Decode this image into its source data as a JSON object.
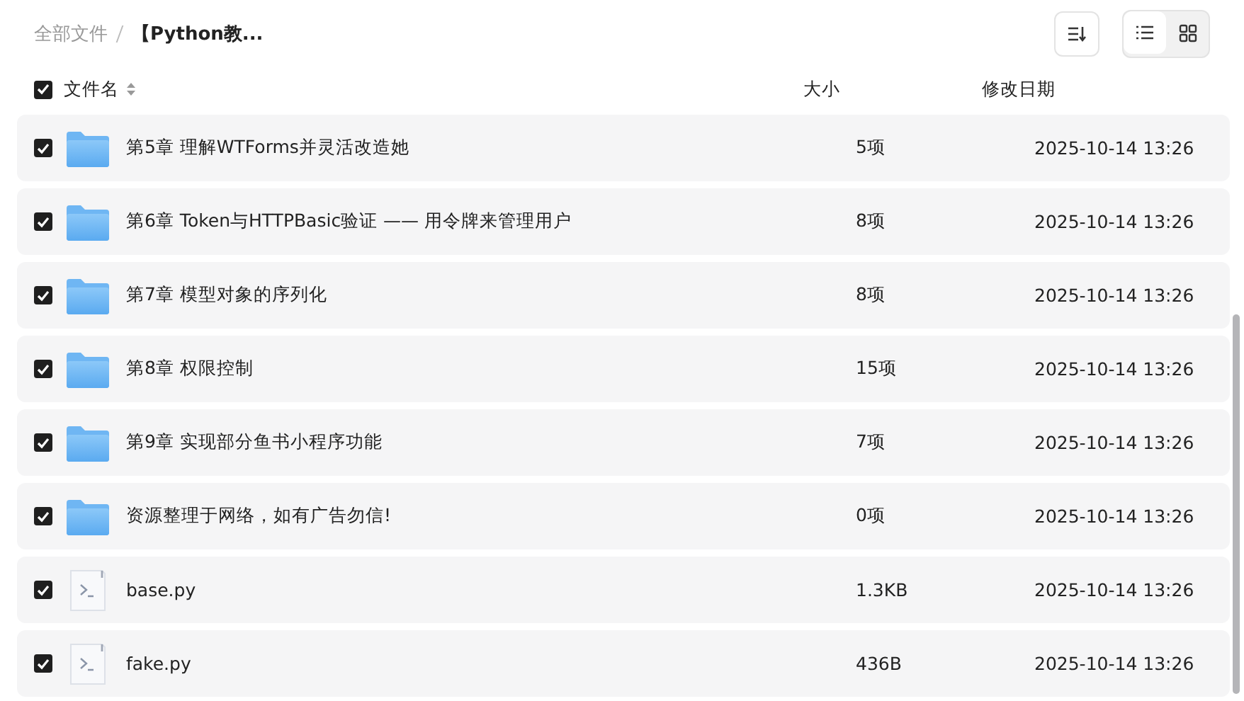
{
  "breadcrumb": [
    {
      "label": "全部文件",
      "current": false
    },
    {
      "label": "【Python教...",
      "current": true
    }
  ],
  "view_modes": [
    {
      "kind": "list",
      "selected": true
    },
    {
      "kind": "grid",
      "selected": false
    }
  ],
  "header": {
    "checked": true,
    "columns": [
      "文件名",
      "大小",
      "修改日期"
    ]
  },
  "rows": [
    {
      "kind": "folder",
      "name": "第5章 理解WTForms并灵活改造她",
      "size": "5项",
      "date": "2025-10-14 13:26",
      "checked": true
    },
    {
      "kind": "folder",
      "name": "第6章 Token与HTTPBasic验证 —— 用令牌来管理用户",
      "size": "8项",
      "date": "2025-10-14 13:26",
      "checked": true
    },
    {
      "kind": "folder",
      "name": "第7章 模型对象的序列化",
      "size": "8项",
      "date": "2025-10-14 13:26",
      "checked": true
    },
    {
      "kind": "folder",
      "name": "第8章 权限控制",
      "size": "15项",
      "date": "2025-10-14 13:26",
      "checked": true
    },
    {
      "kind": "folder",
      "name": "第9章 实现部分鱼书小程序功能",
      "size": "7项",
      "date": "2025-10-14 13:26",
      "checked": true
    },
    {
      "kind": "folder",
      "name": "资源整理于网络，如有广告勿信!",
      "size": "0项",
      "date": "2025-10-14 13:26",
      "checked": true
    },
    {
      "kind": "script",
      "name": "base.py",
      "size": "1.3KB",
      "date": "2025-10-14 13:26",
      "checked": true
    },
    {
      "kind": "script",
      "name": "fake.py",
      "size": "436B",
      "date": "2025-10-14 13:26",
      "checked": true
    }
  ]
}
